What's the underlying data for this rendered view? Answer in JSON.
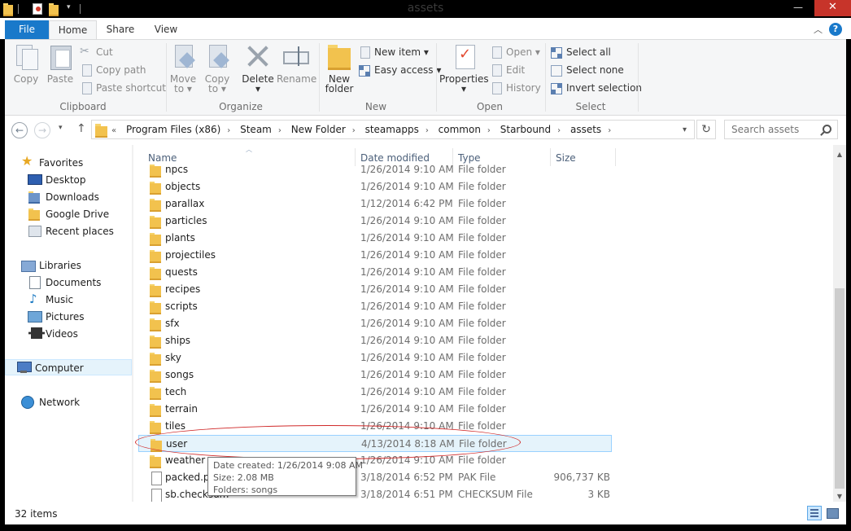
{
  "window": {
    "title": "assets",
    "minimize": "—",
    "maximize": "▭",
    "close": "✕"
  },
  "tabs": {
    "file": "File",
    "home": "Home",
    "share": "Share",
    "view": "View",
    "collapse": "︿",
    "help": "?"
  },
  "ribbon": {
    "clipboard": {
      "group": "Clipboard",
      "copy": "Copy",
      "paste": "Paste",
      "cut": "Cut",
      "copy_path": "Copy path",
      "paste_shortcut": "Paste shortcut"
    },
    "organize": {
      "group": "Organize",
      "move_to": "Move",
      "move_to_2": "to ▾",
      "copy_to": "Copy",
      "copy_to_2": "to ▾",
      "delete": "Delete",
      "delete_2": "▾",
      "rename": "Rename"
    },
    "new": {
      "group": "New",
      "new_folder": "New",
      "new_folder_2": "folder",
      "new_item": "New item ▾",
      "easy_access": "Easy access ▾"
    },
    "open": {
      "group": "Open",
      "properties": "Properties",
      "properties_2": "▾",
      "open": "Open ▾",
      "edit": "Edit",
      "history": "History"
    },
    "select": {
      "group": "Select",
      "select_all": "Select all",
      "select_none": "Select none",
      "invert": "Invert selection"
    }
  },
  "nav": {
    "back": "←",
    "forward": "→",
    "recent": "▾",
    "up": "↑",
    "breadcrumb_prefix": "«",
    "crumbs": [
      "Program Files (x86)",
      "Steam",
      "New Folder",
      "steamapps",
      "common",
      "Starbound",
      "assets"
    ],
    "sep": "›",
    "addr_dropdown": "▾",
    "refresh": "↻",
    "search_placeholder": "Search assets"
  },
  "sidebar": {
    "favorites": "Favorites",
    "desktop": "Desktop",
    "downloads": "Downloads",
    "google_drive": "Google Drive",
    "recent_places": "Recent places",
    "libraries": "Libraries",
    "documents": "Documents",
    "music": "Music",
    "pictures": "Pictures",
    "videos": "Videos",
    "computer": "Computer",
    "network": "Network"
  },
  "columns": {
    "name": "Name",
    "date": "Date modified",
    "type": "Type",
    "size": "Size",
    "sort": "︿"
  },
  "files": [
    {
      "name": "npcs",
      "date": "1/26/2014 9:10 AM",
      "type": "File folder",
      "size": "",
      "kind": "folder"
    },
    {
      "name": "objects",
      "date": "1/26/2014 9:10 AM",
      "type": "File folder",
      "size": "",
      "kind": "folder"
    },
    {
      "name": "parallax",
      "date": "1/12/2014 6:42 PM",
      "type": "File folder",
      "size": "",
      "kind": "folder"
    },
    {
      "name": "particles",
      "date": "1/26/2014 9:10 AM",
      "type": "File folder",
      "size": "",
      "kind": "folder"
    },
    {
      "name": "plants",
      "date": "1/26/2014 9:10 AM",
      "type": "File folder",
      "size": "",
      "kind": "folder"
    },
    {
      "name": "projectiles",
      "date": "1/26/2014 9:10 AM",
      "type": "File folder",
      "size": "",
      "kind": "folder"
    },
    {
      "name": "quests",
      "date": "1/26/2014 9:10 AM",
      "type": "File folder",
      "size": "",
      "kind": "folder"
    },
    {
      "name": "recipes",
      "date": "1/26/2014 9:10 AM",
      "type": "File folder",
      "size": "",
      "kind": "folder"
    },
    {
      "name": "scripts",
      "date": "1/26/2014 9:10 AM",
      "type": "File folder",
      "size": "",
      "kind": "folder"
    },
    {
      "name": "sfx",
      "date": "1/26/2014 9:10 AM",
      "type": "File folder",
      "size": "",
      "kind": "folder"
    },
    {
      "name": "ships",
      "date": "1/26/2014 9:10 AM",
      "type": "File folder",
      "size": "",
      "kind": "folder"
    },
    {
      "name": "sky",
      "date": "1/26/2014 9:10 AM",
      "type": "File folder",
      "size": "",
      "kind": "folder"
    },
    {
      "name": "songs",
      "date": "1/26/2014 9:10 AM",
      "type": "File folder",
      "size": "",
      "kind": "folder"
    },
    {
      "name": "tech",
      "date": "1/26/2014 9:10 AM",
      "type": "File folder",
      "size": "",
      "kind": "folder"
    },
    {
      "name": "terrain",
      "date": "1/26/2014 9:10 AM",
      "type": "File folder",
      "size": "",
      "kind": "folder"
    },
    {
      "name": "tiles",
      "date": "1/26/2014 9:10 AM",
      "type": "File folder",
      "size": "",
      "kind": "folder"
    },
    {
      "name": "user",
      "date": "4/13/2014 8:18 AM",
      "type": "File folder",
      "size": "",
      "kind": "folder",
      "selected": true
    },
    {
      "name": "weather",
      "date": "1/26/2014 9:10 AM",
      "type": "File folder",
      "size": "",
      "kind": "folder"
    },
    {
      "name": "packed.pak",
      "date": "3/18/2014 6:52 PM",
      "type": "PAK File",
      "size": "906,737 KB",
      "kind": "file"
    },
    {
      "name": "sb.checksum",
      "date": "3/18/2014 6:51 PM",
      "type": "CHECKSUM File",
      "size": "3 KB",
      "kind": "file"
    }
  ],
  "tooltip": {
    "created": "Date created: 1/26/2014 9:08 AM",
    "size": "Size: 2.08 MB",
    "folders": "Folders: songs"
  },
  "scroll": {
    "up": "▲",
    "down": "▼"
  },
  "status": {
    "items": "32 items"
  }
}
